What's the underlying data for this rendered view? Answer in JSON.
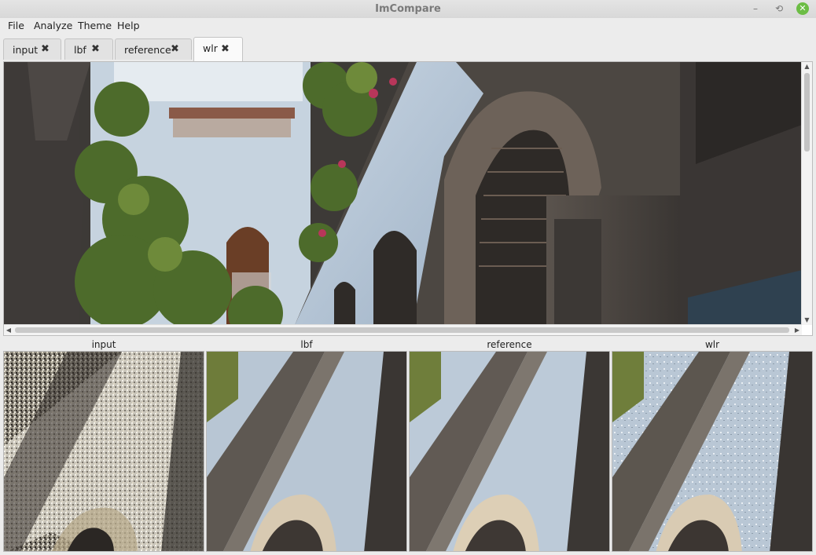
{
  "window": {
    "title": "ImCompare",
    "minimize": "–",
    "maximize": "⟲",
    "close": "✕"
  },
  "menu": [
    "File",
    "Analyze",
    "Theme",
    "Help"
  ],
  "tabs": [
    {
      "label": "input",
      "close": "✖"
    },
    {
      "label": "lbf",
      "close": "✖"
    },
    {
      "label": "reference",
      "close": "✖"
    },
    {
      "label": "wlr",
      "close": "✖",
      "active": true
    }
  ],
  "scroll": {
    "up": "▲",
    "down": "▼",
    "left": "◀",
    "right": "▶"
  },
  "crops": [
    {
      "label": "input"
    },
    {
      "label": "lbf"
    },
    {
      "label": "reference"
    },
    {
      "label": "wlr"
    }
  ],
  "colors": {
    "accent_close": "#6cbd45",
    "wall_blue": "#b9c9d9",
    "stone_dark": "#4a4440",
    "foliage": "#4c6a2a"
  }
}
